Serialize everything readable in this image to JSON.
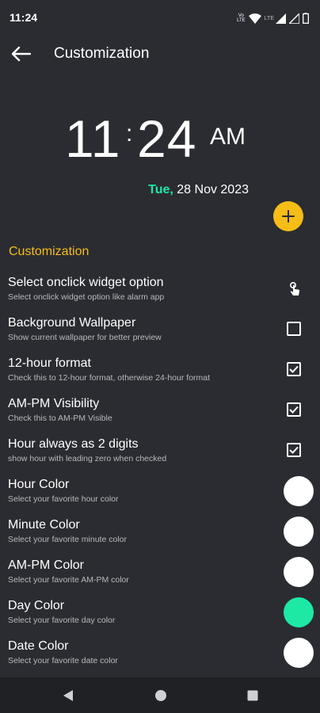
{
  "status_bar": {
    "time": "11:24",
    "volte_top": "Vo",
    "volte_bottom": "LTE",
    "lte_label": "LTE"
  },
  "app_bar": {
    "title": "Customization",
    "back_icon": "arrow-left-icon"
  },
  "clock": {
    "hour": "11",
    "colon": ":",
    "minute": "24",
    "ampm": "AM",
    "day": "Tue,",
    "date": "28 Nov 2023"
  },
  "fab": {
    "icon": "plus-icon"
  },
  "section": {
    "title": "Customization"
  },
  "settings": [
    {
      "title": "Select onclick widget option",
      "subtitle": "Select onclick widget option like alarm app",
      "control": "tap-icon"
    },
    {
      "title": "Background Wallpaper",
      "subtitle": "Show current wallpaper for better preview",
      "control": "checkbox",
      "checked": false
    },
    {
      "title": "12-hour format",
      "subtitle": "Check this to 12-hour format, otherwise 24-hour format",
      "control": "checkbox",
      "checked": true
    },
    {
      "title": "AM-PM Visibility",
      "subtitle": "Check this to AM-PM Visible",
      "control": "checkbox",
      "checked": true
    },
    {
      "title": "Hour always as 2 digits",
      "subtitle": "show hour with leading zero when checked",
      "control": "checkbox",
      "checked": true
    },
    {
      "title": "Hour Color",
      "subtitle": "Select your favorite hour color",
      "control": "swatch",
      "color": "#ffffff"
    },
    {
      "title": "Minute Color",
      "subtitle": "Select your favorite minute color",
      "control": "swatch",
      "color": "#ffffff"
    },
    {
      "title": "AM-PM Color",
      "subtitle": "Select your favorite AM-PM color",
      "control": "swatch",
      "color": "#ffffff"
    },
    {
      "title": "Day Color",
      "subtitle": "Select your favorite day color",
      "control": "swatch",
      "color": "#1de9a5"
    },
    {
      "title": "Date Color",
      "subtitle": "Select your favorite date color",
      "control": "swatch",
      "color": "#ffffff"
    }
  ],
  "colors": {
    "background": "#2b2c31",
    "accent": "#f6bd17",
    "day_text": "#1de9a5",
    "nav_bar": "#202124"
  },
  "nav_bar": {
    "back_icon": "nav-back-icon",
    "home_icon": "nav-home-icon",
    "recents_icon": "nav-recents-icon"
  }
}
